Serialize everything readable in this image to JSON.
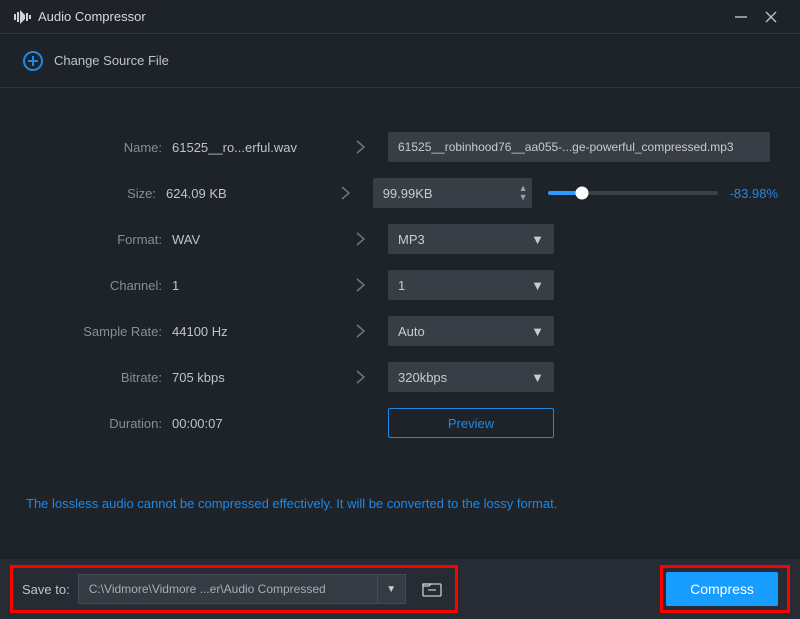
{
  "title": "Audio Compressor",
  "change_source": "Change Source File",
  "fields": {
    "name_label": "Name:",
    "name_value": "61525__ro...erful.wav",
    "name_output": "61525__robinhood76__aa055-...ge-powerful_compressed.mp3",
    "size_label": "Size:",
    "size_value": "624.09 KB",
    "size_new": "99.99KB",
    "size_percent": "-83.98%",
    "format_label": "Format:",
    "format_value": "WAV",
    "format_new": "MP3",
    "channel_label": "Channel:",
    "channel_value": "1",
    "channel_new": "1",
    "samplerate_label": "Sample Rate:",
    "samplerate_value": "44100 Hz",
    "samplerate_new": "Auto",
    "bitrate_label": "Bitrate:",
    "bitrate_value": "705 kbps",
    "bitrate_new": "320kbps",
    "duration_label": "Duration:",
    "duration_value": "00:00:07"
  },
  "preview": "Preview",
  "note": "The lossless audio cannot be compressed effectively. It will be converted to the lossy format.",
  "footer": {
    "save_label": "Save to:",
    "save_path": "C:\\Vidmore\\Vidmore ...er\\Audio Compressed",
    "compress": "Compress"
  }
}
